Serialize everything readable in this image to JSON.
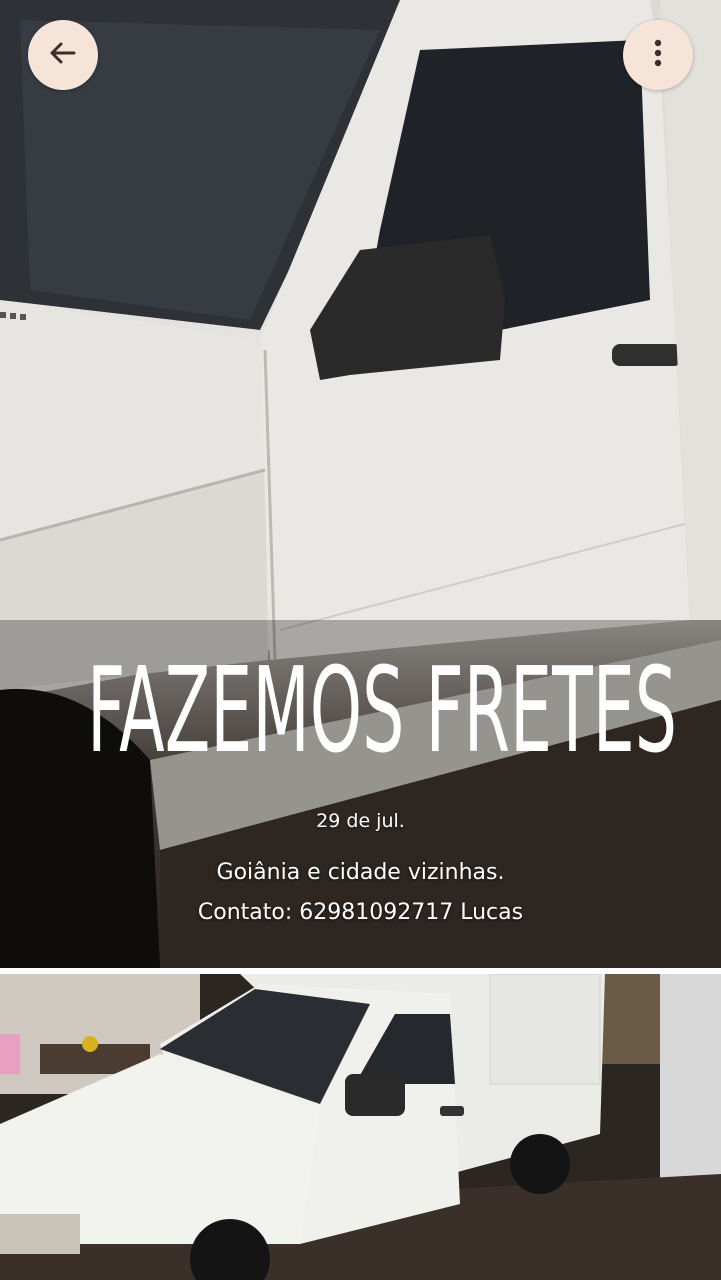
{
  "toolbar": {
    "back_icon": "arrow-left-icon",
    "more_icon": "more-vertical-icon",
    "button_color": "#f7e4d9"
  },
  "post": {
    "headline": "FAZEMOS FRETES",
    "date": "29 de jul.",
    "line1": "Goiânia e cidade vizinhas.",
    "line2": "Contato: 62981092717 Lucas"
  },
  "photos": [
    {
      "subject": "white van door close-up"
    },
    {
      "subject": "white van full side view"
    }
  ]
}
